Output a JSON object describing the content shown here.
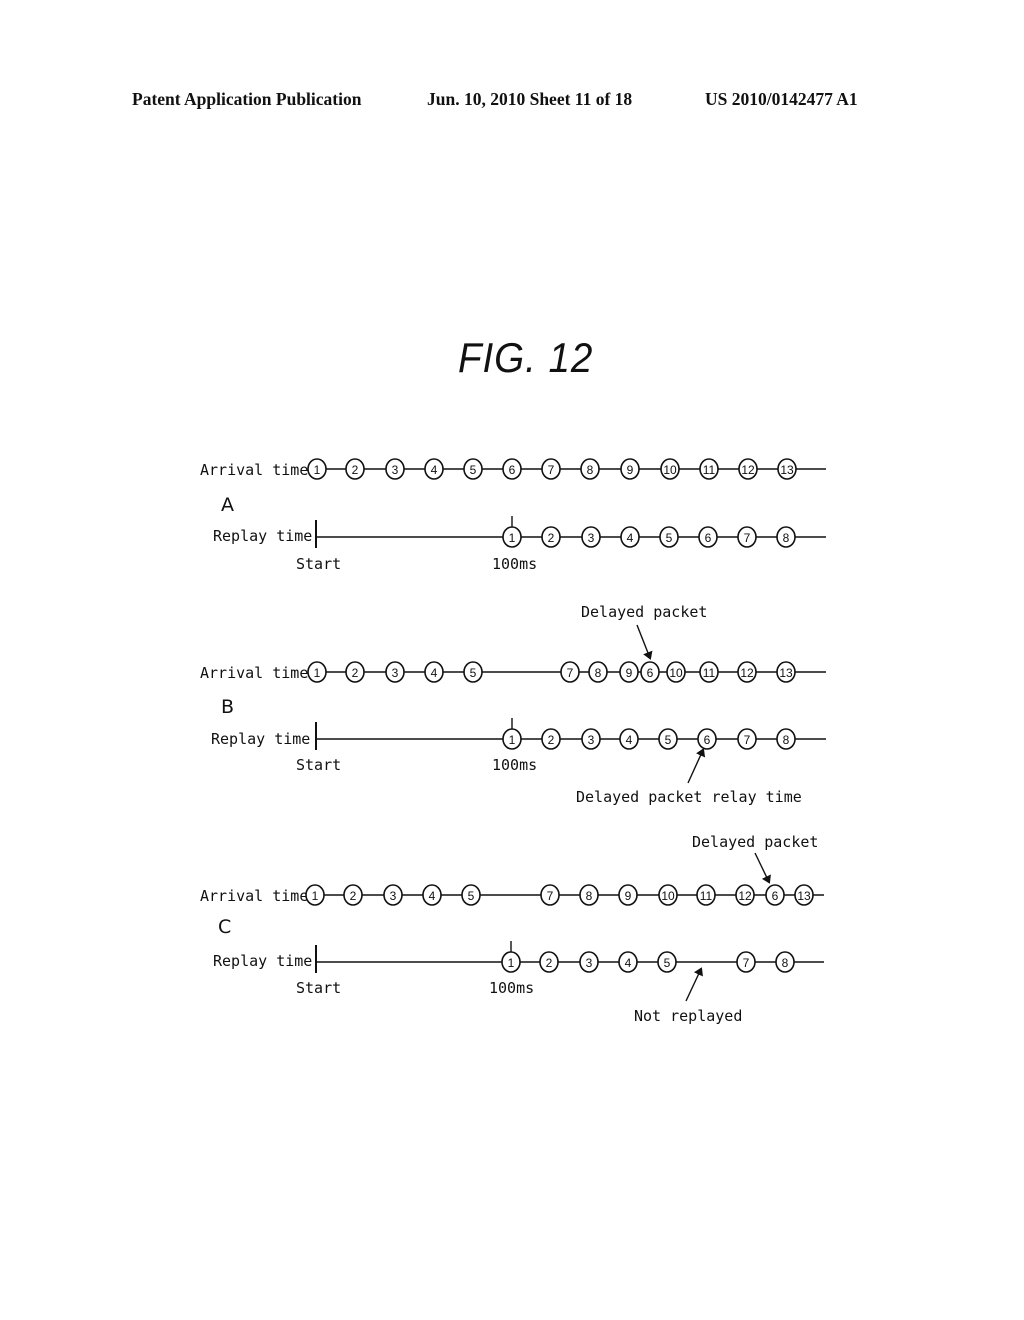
{
  "header": {
    "publication": "Patent Application Publication",
    "date_sheet": "Jun. 10, 2010  Sheet 11 of 18",
    "patent_number": "US 2010/0142477 A1"
  },
  "figure": {
    "title": "FIG. 12",
    "labels": {
      "arrival": "Arrival time",
      "replay": "Replay time",
      "start": "Start",
      "delay_marker": "100ms"
    },
    "panels": [
      {
        "letter": "A",
        "arrival_sequence": [
          "1",
          "2",
          "3",
          "4",
          "5",
          "6",
          "7",
          "8",
          "9",
          "10",
          "11",
          "12",
          "13"
        ],
        "replay_sequence": [
          "1",
          "2",
          "3",
          "4",
          "5",
          "6",
          "7",
          "8"
        ],
        "annotations": []
      },
      {
        "letter": "B",
        "arrival_sequence": [
          "1",
          "2",
          "3",
          "4",
          "5",
          "7",
          "8",
          "9",
          "6",
          "10",
          "11",
          "12",
          "13"
        ],
        "replay_sequence": [
          "1",
          "2",
          "3",
          "4",
          "5",
          "6",
          "7",
          "8"
        ],
        "annotations": [
          {
            "text": "Delayed packet",
            "target": "arrival",
            "target_packet": "6"
          },
          {
            "text": "Delayed packet relay time",
            "target": "replay",
            "target_packet": "6"
          }
        ]
      },
      {
        "letter": "C",
        "arrival_sequence": [
          "1",
          "2",
          "3",
          "4",
          "5",
          "7",
          "8",
          "9",
          "10",
          "11",
          "12",
          "6",
          "13"
        ],
        "replay_sequence": [
          "1",
          "2",
          "3",
          "4",
          "5",
          "",
          "7",
          "8"
        ],
        "annotations": [
          {
            "text": "Delayed packet",
            "target": "arrival",
            "target_packet": "6"
          },
          {
            "text": "Not replayed",
            "target": "replay",
            "target_packet": "6"
          }
        ]
      }
    ]
  }
}
